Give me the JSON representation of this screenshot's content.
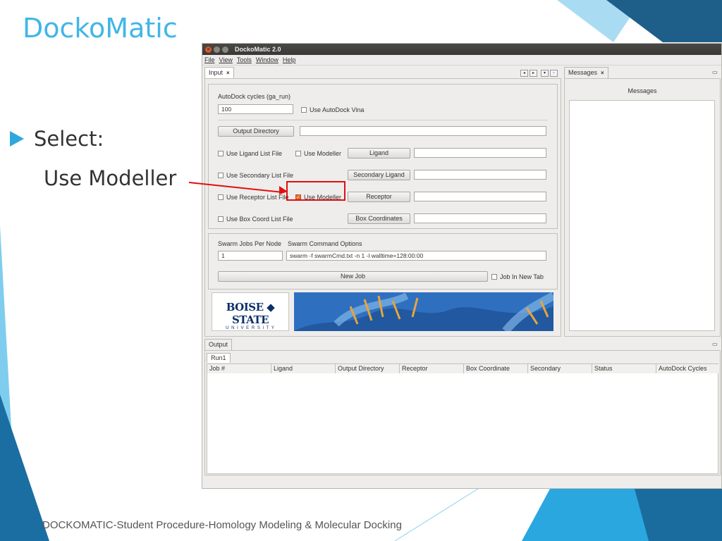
{
  "slide": {
    "title": "DockoMatic",
    "bullet": "Select:",
    "sub_bullet": "Use Modeller",
    "footer": "DOCKOMATIC-Student Procedure-Homology Modeling & Molecular Docking"
  },
  "window": {
    "title": "DockoMatic 2.0",
    "menu": [
      "File",
      "View",
      "Tools",
      "Window",
      "Help"
    ]
  },
  "input_tab": {
    "label": "Input",
    "autodock_cycles_label": "AutoDock cycles (ga_run)",
    "autodock_cycles_value": "100",
    "use_vina_label": "Use AutoDock Vina",
    "output_directory_button": "Output Directory",
    "output_directory_value": "",
    "use_ligand_list": "Use Ligand List File",
    "use_modeller_ligand": "Use Modeller",
    "ligand_button": "Ligand",
    "use_secondary_list": "Use Secondary List File",
    "secondary_ligand_button": "Secondary Ligand",
    "use_receptor_list": "Use Receptor List File",
    "use_modeller_receptor": "Use Modeller",
    "use_modeller_receptor_checked": true,
    "receptor_button": "Receptor",
    "use_box_coord_list": "Use Box Coord List File",
    "box_coordinates_button": "Box Coordinates",
    "swarm_jobs_label": "Swarm Jobs Per Node",
    "swarm_jobs_value": "1",
    "swarm_cmd_label": "Swarm Command Options",
    "swarm_cmd_value": "swarm -f swarmCmd.txt -n 1 -l walltime=128:00:00",
    "new_job_button": "New Job",
    "job_in_new_tab": "Job In New Tab",
    "logo_line1": "BOISE ◆ STATE",
    "logo_line2": "U N I V E R S I T Y"
  },
  "messages_tab": {
    "label": "Messages",
    "heading": "Messages"
  },
  "output": {
    "label": "Output",
    "run_tab": "Run1",
    "columns": [
      "Job #",
      "Ligand",
      "Output Directory",
      "Receptor",
      "Box Coordinate",
      "Secondary",
      "Status",
      "AutoDock Cycles"
    ]
  },
  "colors": {
    "accent": "#41b6e6",
    "highlight": "#e01010",
    "checkbox": "#e06b2e"
  }
}
